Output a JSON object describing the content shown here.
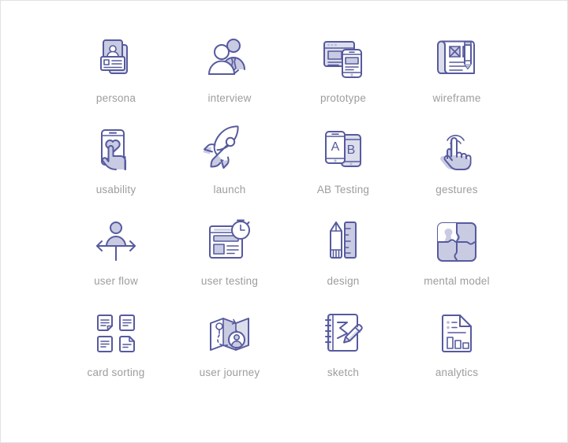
{
  "page": {
    "background_color": "#ffffff",
    "border_color": "#e2e2e2",
    "icon_stroke_color": "#575a9e",
    "icon_fill_color": "#c9cbe2",
    "label_color": "#9d9d9d",
    "columns": 4,
    "rows": 4
  },
  "icons": [
    {
      "id": "persona",
      "label": "persona",
      "icon_name": "persona-icon"
    },
    {
      "id": "interview",
      "label": "interview",
      "icon_name": "interview-icon"
    },
    {
      "id": "prototype",
      "label": "prototype",
      "icon_name": "prototype-icon"
    },
    {
      "id": "wireframe",
      "label": "wireframe",
      "icon_name": "wireframe-icon"
    },
    {
      "id": "usability",
      "label": "usability",
      "icon_name": "usability-icon"
    },
    {
      "id": "launch",
      "label": "launch",
      "icon_name": "launch-rocket-icon"
    },
    {
      "id": "ab_testing",
      "label": "AB Testing",
      "icon_name": "ab-testing-icon",
      "letter_a": "A",
      "letter_b": "B"
    },
    {
      "id": "gestures",
      "label": "gestures",
      "icon_name": "gestures-hand-icon"
    },
    {
      "id": "user_flow",
      "label": "user flow",
      "icon_name": "user-flow-icon"
    },
    {
      "id": "user_testing",
      "label": "user testing",
      "icon_name": "user-testing-icon"
    },
    {
      "id": "design",
      "label": "design",
      "icon_name": "design-pencil-ruler-icon"
    },
    {
      "id": "mental_model",
      "label": "mental model",
      "icon_name": "mental-model-puzzle-icon"
    },
    {
      "id": "card_sorting",
      "label": "card sorting",
      "icon_name": "card-sorting-icon"
    },
    {
      "id": "user_journey",
      "label": "user journey",
      "icon_name": "user-journey-map-icon"
    },
    {
      "id": "sketch",
      "label": "sketch",
      "icon_name": "sketch-notebook-icon"
    },
    {
      "id": "analytics",
      "label": "analytics",
      "icon_name": "analytics-document-icon"
    }
  ]
}
